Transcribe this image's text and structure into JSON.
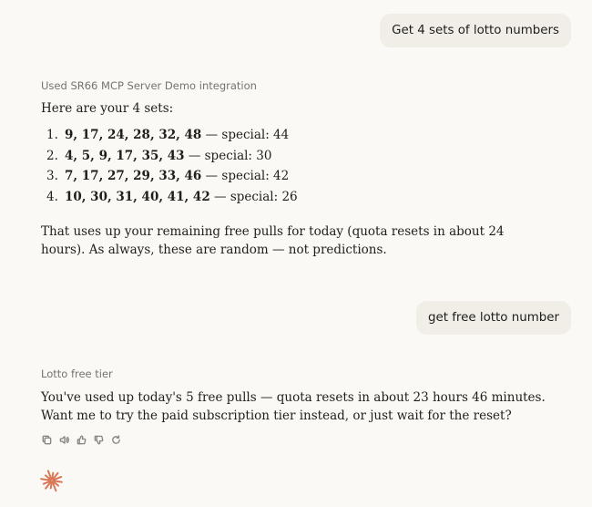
{
  "conversation": {
    "user_message_1": "Get 4 sets of lotto numbers",
    "tool_label_1": "Used SR66 MCP Server Demo integration",
    "intro": "Here are your 4 sets:",
    "sets": [
      {
        "index": "1.",
        "numbers": "9, 17, 24, 28, 32, 48",
        "special": " — special: 44"
      },
      {
        "index": "2.",
        "numbers": "4, 5, 9, 17, 35, 43",
        "special": " — special: 30"
      },
      {
        "index": "3.",
        "numbers": "7, 17, 27, 29, 33, 46",
        "special": " — special: 42"
      },
      {
        "index": "4.",
        "numbers": "10, 30, 31, 40, 41, 42",
        "special": " — special: 26"
      }
    ],
    "quota_note": "That uses up your remaining free pulls for today (quota resets in about 24 hours). As always, these are random — not predictions.",
    "user_message_2": "get free lotto number",
    "tool_label_2": "Lotto free tier",
    "reply": "You've used up today's 5 free pulls — quota resets in about 23 hours 46 minutes. Want me to try the paid subscription tier instead, or just wait for the reset?"
  },
  "actions": [
    "copy-icon",
    "speaker-icon",
    "thumbs-up-icon",
    "thumbs-down-icon",
    "retry-icon"
  ],
  "colors": {
    "background": "#faf9f5",
    "user_bubble": "#f0eee6",
    "muted_text": "#75736b",
    "brand_accent": "#d97757"
  }
}
